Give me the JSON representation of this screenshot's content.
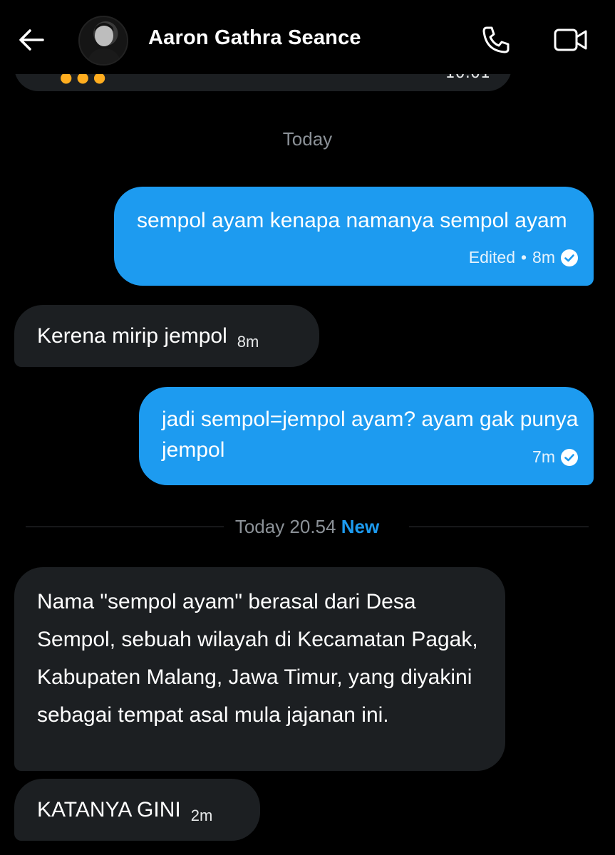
{
  "header": {
    "title": "Aaron Gathra Seance"
  },
  "previous_message": {
    "time_partial": "10:01"
  },
  "day_separator": {
    "label": "Today"
  },
  "messages": [
    {
      "direction": "out",
      "text": "sempol ayam kenapa namanya sempol ayam",
      "edited": "Edited",
      "time": "8m",
      "read": true
    },
    {
      "direction": "in",
      "text": "Kerena mirip jempol",
      "time": "8m"
    },
    {
      "direction": "out",
      "text": "jadi sempol=jempol ayam? ayam gak punya jempol",
      "time": "7m",
      "read": true
    },
    {
      "direction": "in",
      "text": "Nama \"sempol ayam\" berasal dari Desa Sempol, sebuah wilayah di Kecamatan Pagak, Kabupaten Malang, Jawa Timur, yang diyakini sebagai tempat asal mula jajanan ini."
    },
    {
      "direction": "in",
      "text": "KATANYA GINI",
      "time": "2m"
    }
  ],
  "new_divider": {
    "time": "Today 20.54",
    "badge": "New"
  },
  "colors": {
    "accent": "#1d9bf0",
    "incoming_bubble": "#1c1f22",
    "background": "#000000"
  },
  "icons": [
    "back-arrow-icon",
    "phone-icon",
    "video-call-icon",
    "read-check-icon"
  ]
}
